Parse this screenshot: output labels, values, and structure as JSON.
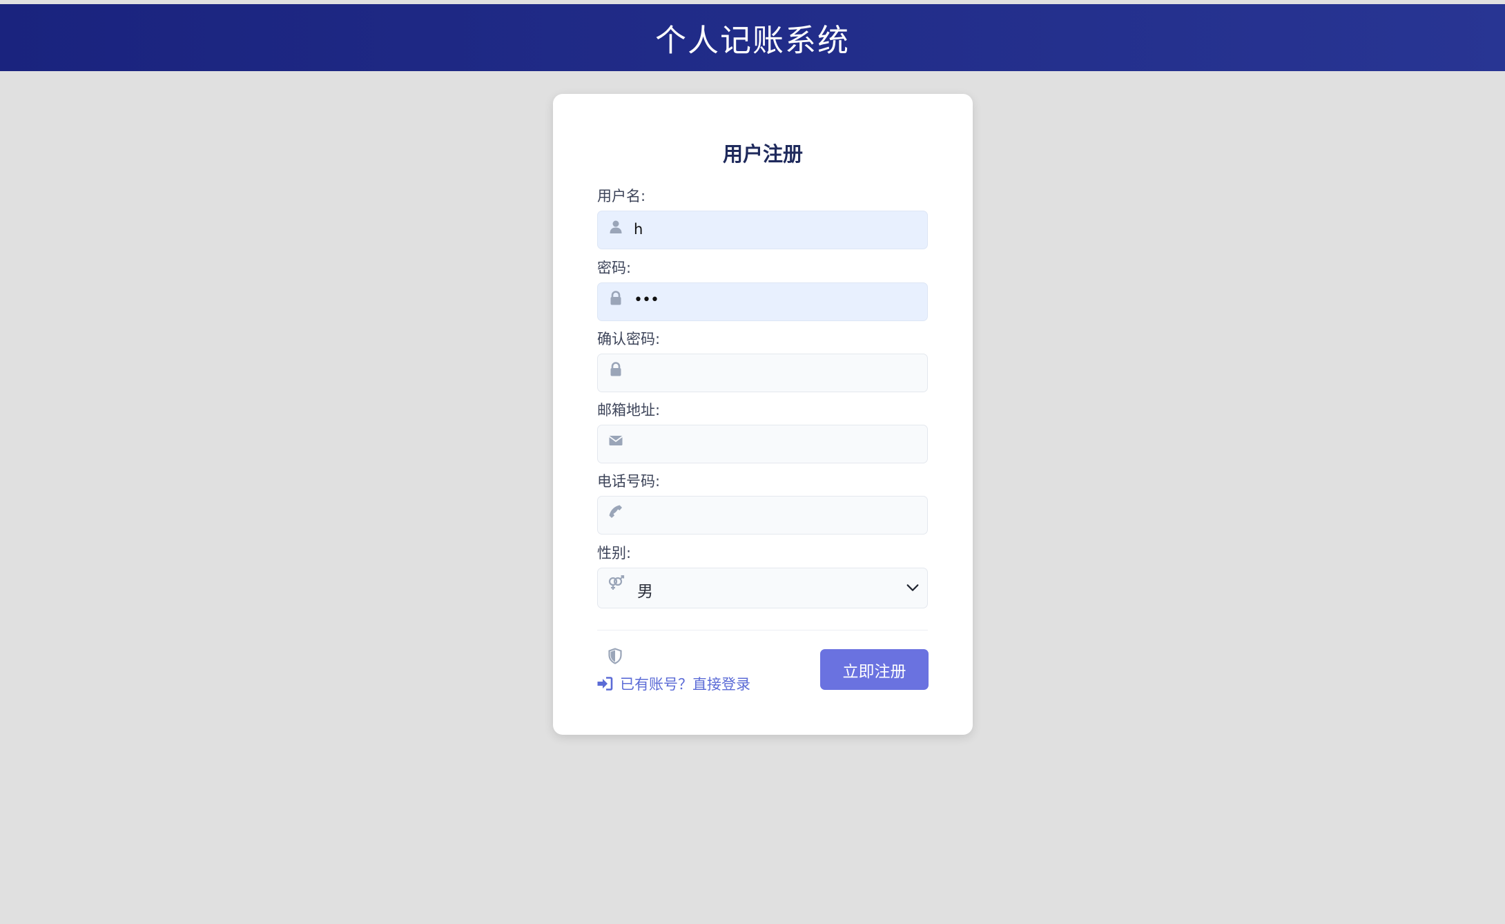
{
  "header": {
    "title": "个人记账系统"
  },
  "form": {
    "title": "用户注册",
    "fields": {
      "username": {
        "label": "用户名:",
        "value": "h",
        "icon": "user-icon"
      },
      "password": {
        "label": "密码:",
        "value": "•••",
        "icon": "lock-icon"
      },
      "confirm_password": {
        "label": "确认密码:",
        "value": "",
        "icon": "lock-icon"
      },
      "email": {
        "label": "邮箱地址:",
        "value": "",
        "icon": "envelope-icon"
      },
      "phone": {
        "label": "电话号码:",
        "value": "",
        "icon": "phone-icon"
      },
      "gender": {
        "label": "性别:",
        "value": "男",
        "icon": "gender-icon"
      }
    },
    "login_link": "已有账号？直接登录",
    "submit_label": "立即注册"
  },
  "colors": {
    "header_start": "#1a237e",
    "header_end": "#283593",
    "accent": "#6a72e0",
    "link": "#5b6bd6",
    "filled_input": "#e8f0fe"
  }
}
